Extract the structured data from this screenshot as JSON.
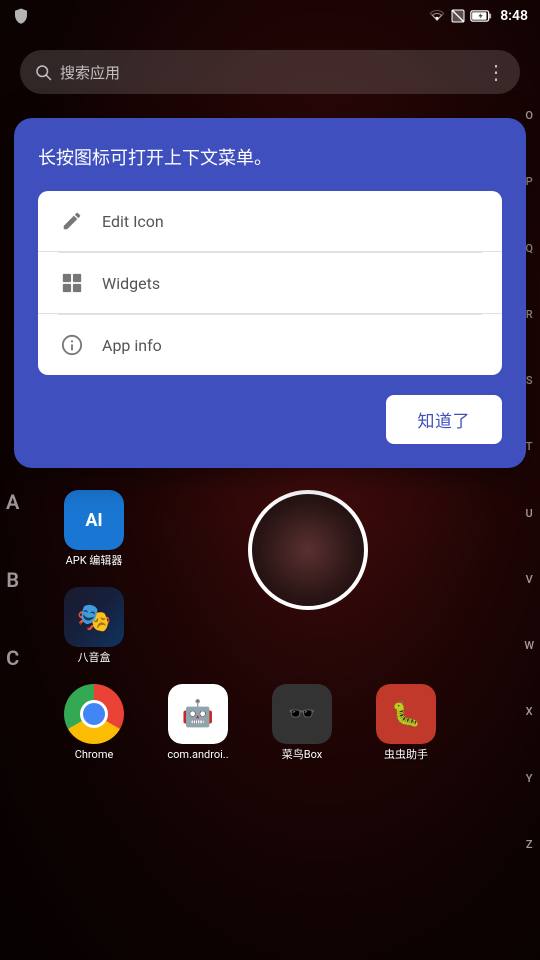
{
  "statusBar": {
    "time": "8:48",
    "icons": [
      "wifi",
      "no-sim",
      "battery"
    ]
  },
  "searchBar": {
    "placeholder": "搜索应用",
    "moreIcon": "⋮"
  },
  "dialog": {
    "hintText": "长按图标可打开上下文菜单。",
    "menuItems": [
      {
        "id": "edit-icon",
        "icon": "pencil",
        "label": "Edit Icon"
      },
      {
        "id": "widgets",
        "icon": "widgets",
        "label": "Widgets"
      },
      {
        "id": "app-info",
        "icon": "info",
        "label": "App info"
      }
    ],
    "confirmButton": "知道了"
  },
  "alphaSidebar": {
    "letters": [
      "O",
      "P",
      "Q",
      "R",
      "S",
      "T",
      "U",
      "V",
      "W",
      "X",
      "Y",
      "Z"
    ]
  },
  "alphaLeft": {
    "letters": [
      "A",
      "B",
      "C"
    ]
  },
  "apps": {
    "sectionA": [
      {
        "name": "APK 编辑器",
        "iconType": "apk"
      }
    ],
    "sectionB": [
      {
        "name": "八音盒",
        "iconType": "bayinhe"
      }
    ],
    "sectionC": [
      {
        "name": "Chrome",
        "iconType": "chrome"
      },
      {
        "name": "com.androi..",
        "iconType": "android"
      },
      {
        "name": "菜鸟Box",
        "iconType": "cainiao"
      },
      {
        "name": "虫虫助手",
        "iconType": "chongchong"
      }
    ]
  },
  "colors": {
    "dialogBg": "#3f51d0",
    "buttonBg": "#ffffff",
    "buttonText": "#3f51d0"
  }
}
